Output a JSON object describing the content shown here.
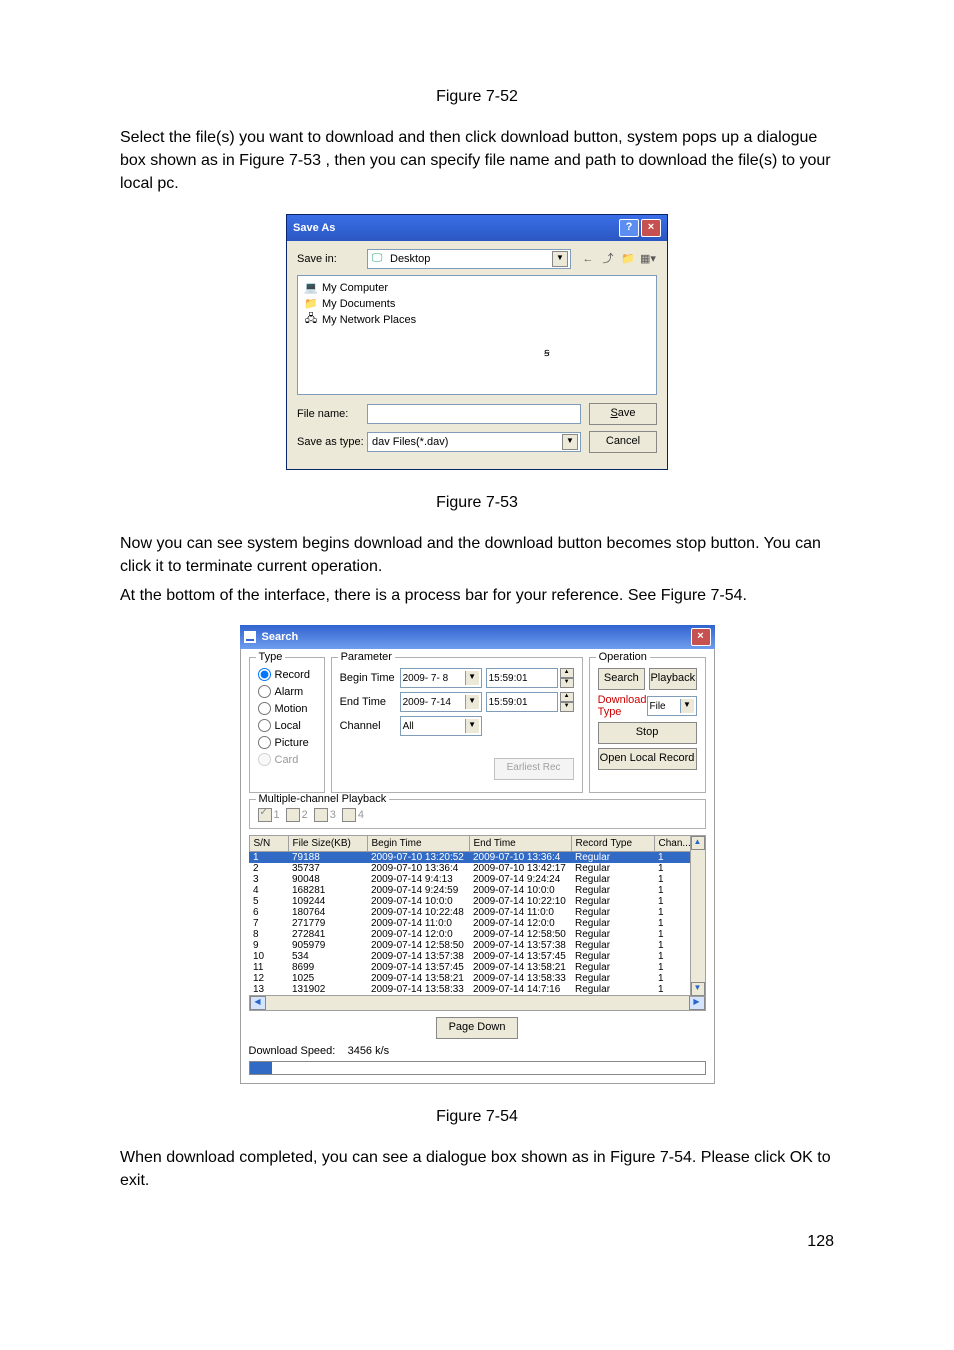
{
  "figure_caption_752": "Figure 7-52",
  "body_paragraph_1": "Select the file(s) you want to download and then click download button, system pops up a dialogue box shown as in Figure 7-53 , then you can specify file name and path to download the file(s) to your local pc.",
  "figure_caption_753": "Figure 7-53",
  "body_paragraph_2a": "Now you can see system begins download and the download button becomes stop button. You can click it to terminate current operation.",
  "body_paragraph_2b": "At the bottom of the interface, there is a process bar for your reference. See Figure 7-54.",
  "figure_caption_754": "Figure 7-54",
  "body_paragraph_3": "When download completed, you can see a dialogue box shown as in Figure 7-54. Please click OK to exit.",
  "page_number": "128",
  "saveas": {
    "title": "Save As",
    "save_in_label": "Save in:",
    "save_in_value": "Desktop",
    "items": {
      "a": "My Computer",
      "b": "My Documents",
      "c": "My Network Places"
    },
    "cursor_mark": "",
    "file_name_label": "File name:",
    "file_name_value": "",
    "save_as_type_label": "Save as type:",
    "save_as_type_value": "dav Files(*.dav)",
    "save_btn": "Save",
    "cancel_btn": "Cancel"
  },
  "search": {
    "title": "Search",
    "type": {
      "group_title": "Type",
      "record": "Record",
      "alarm": "Alarm",
      "motion": "Motion",
      "local": "Local",
      "picture": "Picture",
      "card": "Card"
    },
    "parameter": {
      "group_title": "Parameter",
      "begin_label": "Begin Time",
      "begin_date": "2009- 7- 8",
      "begin_time": "15:59:01",
      "end_label": "End Time",
      "end_date": "2009- 7-14",
      "end_time": "15:59:01",
      "channel_label": "Channel",
      "channel_value": "All",
      "earliest": "Earliest Rec"
    },
    "operation": {
      "group_title": "Operation",
      "search": "Search",
      "playback": "Playback",
      "dl_type_label": "Download Type",
      "dl_type_value": "File",
      "stop": "Stop",
      "open_local": "Open Local Record"
    },
    "mpb": {
      "group_title": "Multiple-channel Playback",
      "c1": "1",
      "c2": "2",
      "c3": "3",
      "c4": "4"
    },
    "columns": {
      "sn": "S/N",
      "size": "File Size(KB)",
      "begin": "Begin Time",
      "end": "End Time",
      "type": "Record Type",
      "chan": "Chan..."
    },
    "rows": [
      {
        "sn": "1",
        "size": "79188",
        "begin": "2009-07-10 13:20:52",
        "end": "2009-07-10 13:36:4",
        "type": "Regular",
        "chan": "1"
      },
      {
        "sn": "2",
        "size": "35737",
        "begin": "2009-07-10 13:36:4",
        "end": "2009-07-10 13:42:17",
        "type": "Regular",
        "chan": "1"
      },
      {
        "sn": "3",
        "size": "90048",
        "begin": "2009-07-14 9:4:13",
        "end": "2009-07-14 9:24:24",
        "type": "Regular",
        "chan": "1"
      },
      {
        "sn": "4",
        "size": "168281",
        "begin": "2009-07-14 9:24:59",
        "end": "2009-07-14 10:0:0",
        "type": "Regular",
        "chan": "1"
      },
      {
        "sn": "5",
        "size": "109244",
        "begin": "2009-07-14 10:0:0",
        "end": "2009-07-14 10:22:10",
        "type": "Regular",
        "chan": "1"
      },
      {
        "sn": "6",
        "size": "180764",
        "begin": "2009-07-14 10:22:48",
        "end": "2009-07-14 11:0:0",
        "type": "Regular",
        "chan": "1"
      },
      {
        "sn": "7",
        "size": "271779",
        "begin": "2009-07-14 11:0:0",
        "end": "2009-07-14 12:0:0",
        "type": "Regular",
        "chan": "1"
      },
      {
        "sn": "8",
        "size": "272841",
        "begin": "2009-07-14 12:0:0",
        "end": "2009-07-14 12:58:50",
        "type": "Regular",
        "chan": "1"
      },
      {
        "sn": "9",
        "size": "905979",
        "begin": "2009-07-14 12:58:50",
        "end": "2009-07-14 13:57:38",
        "type": "Regular",
        "chan": "1"
      },
      {
        "sn": "10",
        "size": "534",
        "begin": "2009-07-14 13:57:38",
        "end": "2009-07-14 13:57:45",
        "type": "Regular",
        "chan": "1"
      },
      {
        "sn": "11",
        "size": "8699",
        "begin": "2009-07-14 13:57:45",
        "end": "2009-07-14 13:58:21",
        "type": "Regular",
        "chan": "1"
      },
      {
        "sn": "12",
        "size": "1025",
        "begin": "2009-07-14 13:58:21",
        "end": "2009-07-14 13:58:33",
        "type": "Regular",
        "chan": "1"
      },
      {
        "sn": "13",
        "size": "131902",
        "begin": "2009-07-14 13:58:33",
        "end": "2009-07-14 14:7:16",
        "type": "Regular",
        "chan": "1"
      }
    ],
    "page_down": "Page Down",
    "dl_speed_label": "Download Speed:",
    "dl_speed_value": "3456 k/s"
  }
}
